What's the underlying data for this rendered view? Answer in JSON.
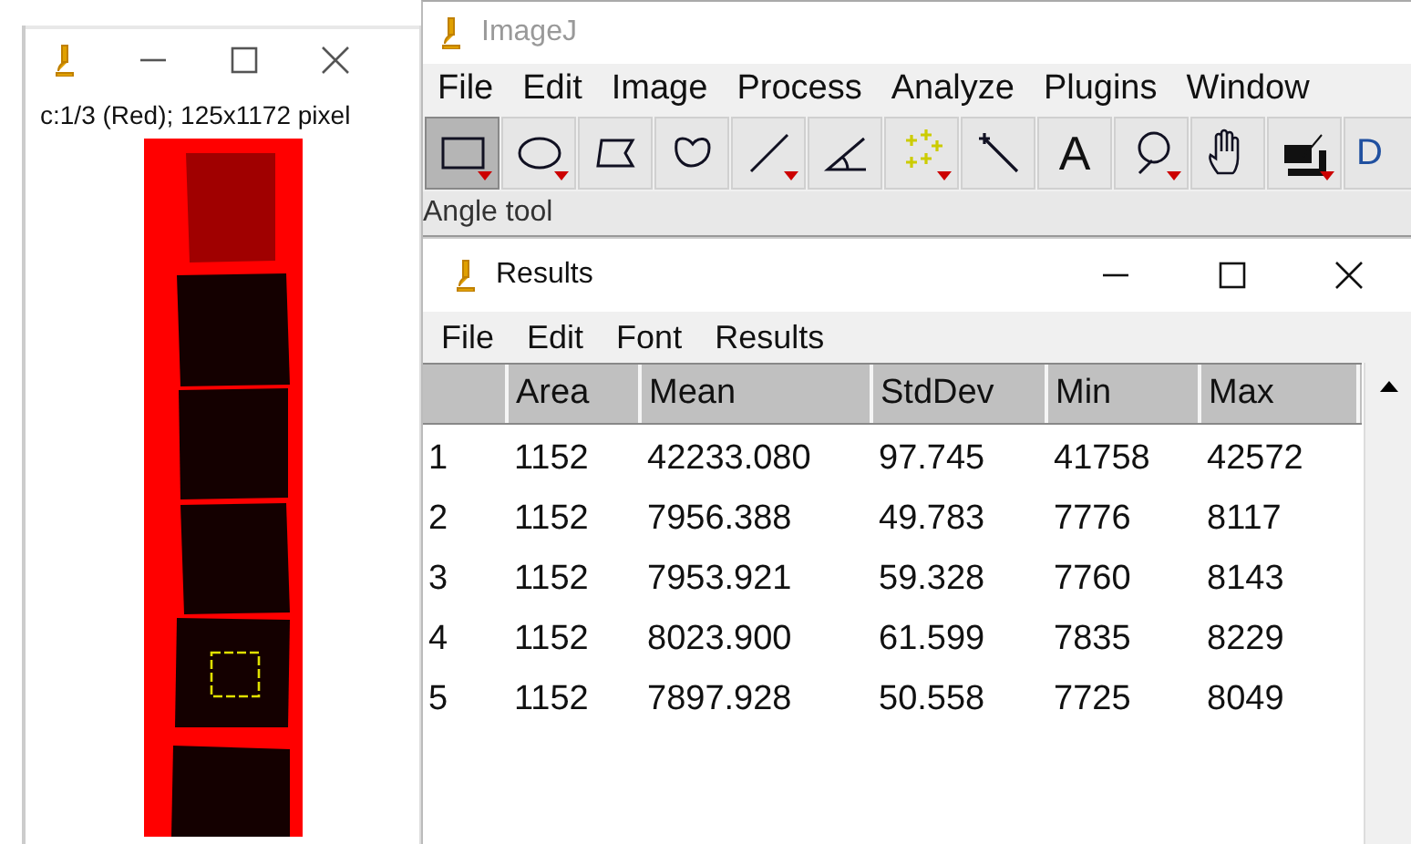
{
  "image_window": {
    "subtitle": "c:1/3 (Red); 125x1172 pixel"
  },
  "imagej": {
    "title": "ImageJ",
    "active": false,
    "menu": [
      "File",
      "Edit",
      "Image",
      "Process",
      "Analyze",
      "Plugins",
      "Window"
    ],
    "tools": [
      {
        "kind": "rectangle",
        "selected": true,
        "has_menu": true
      },
      {
        "kind": "oval",
        "selected": false,
        "has_menu": true
      },
      {
        "kind": "polygon",
        "selected": false,
        "has_menu": false
      },
      {
        "kind": "freehand",
        "selected": false,
        "has_menu": false
      },
      {
        "kind": "line",
        "selected": false,
        "has_menu": true
      },
      {
        "kind": "angle",
        "selected": false,
        "has_menu": false
      },
      {
        "kind": "points",
        "selected": false,
        "has_menu": true
      },
      {
        "kind": "wand",
        "selected": false,
        "has_menu": false
      },
      {
        "kind": "text",
        "label": "A",
        "selected": false,
        "has_menu": false
      },
      {
        "kind": "zoom",
        "selected": false,
        "has_menu": true
      },
      {
        "kind": "hand",
        "selected": false,
        "has_menu": false
      },
      {
        "kind": "dropper",
        "selected": false,
        "has_menu": true
      },
      {
        "kind": "text",
        "label": "D",
        "selected": false,
        "has_menu": false
      }
    ],
    "status": "Angle tool"
  },
  "results": {
    "title": "Results",
    "active": true,
    "menu": [
      "File",
      "Edit",
      "Font",
      "Results"
    ],
    "columns": [
      "Area",
      "Mean",
      "StdDev",
      "Min",
      "Max"
    ],
    "rows": [
      {
        "label": "1",
        "cells": [
          "1152",
          "42233.080",
          "97.745",
          "41758",
          "42572"
        ]
      },
      {
        "label": "2",
        "cells": [
          "1152",
          "7956.388",
          "49.783",
          "7776",
          "8117"
        ]
      },
      {
        "label": "3",
        "cells": [
          "1152",
          "7953.921",
          "59.328",
          "7760",
          "8143"
        ]
      },
      {
        "label": "4",
        "cells": [
          "1152",
          "8023.900",
          "61.599",
          "7835",
          "8229"
        ]
      },
      {
        "label": "5",
        "cells": [
          "1152",
          "7897.928",
          "50.558",
          "7725",
          "8049"
        ]
      }
    ]
  }
}
